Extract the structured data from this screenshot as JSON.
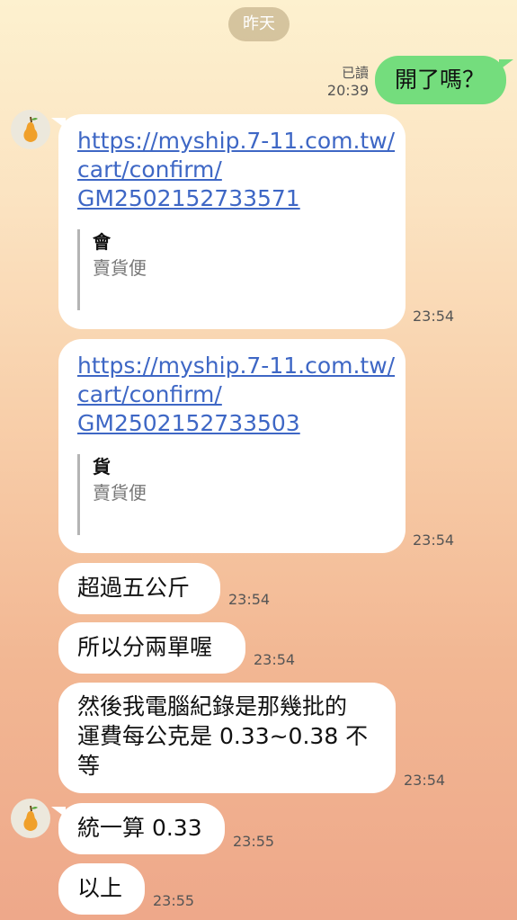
{
  "date_label": "昨天",
  "outgoing": {
    "text": "開了嗎？",
    "read_label": "已讀",
    "time": "20:39"
  },
  "messages": [
    {
      "link_lines": [
        "https://myship.7-11.com.tw/",
        "cart/confirm/",
        "GM2502152733571"
      ],
      "quote_title": "會",
      "quote_subtitle": "賣貨便",
      "time": "23:54"
    },
    {
      "link_lines": [
        "https://myship.7-11.com.tw/",
        "cart/confirm/",
        "GM2502152733503"
      ],
      "quote_title": "貨",
      "quote_subtitle": "賣貨便",
      "time": "23:54"
    },
    {
      "text": "超過五公斤",
      "time": "23:54"
    },
    {
      "text": "所以分兩單喔",
      "time": "23:54"
    },
    {
      "text_lines": [
        "然後我電腦紀錄是那幾批的",
        "運費每公克是 0.33~0.38 不",
        "等"
      ],
      "time": "23:54"
    },
    {
      "text": "統一算 0.33",
      "time": "23:55"
    },
    {
      "text": "以上",
      "time": "23:55"
    }
  ],
  "icons": {
    "avatar": "pear-icon"
  }
}
